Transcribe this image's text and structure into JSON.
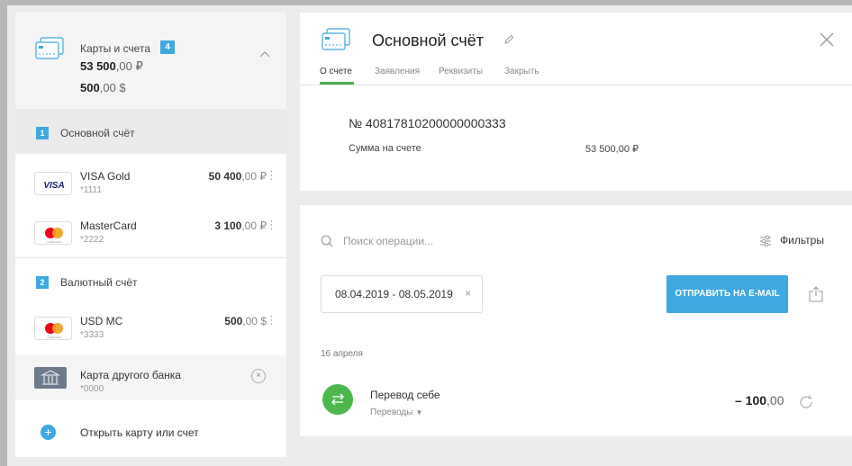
{
  "sidebar": {
    "header": {
      "title": "Карты и счета",
      "count": "4",
      "total_rub": {
        "main": "53 500",
        "fraction": ",00 ₽"
      },
      "total_usd": {
        "main": "500",
        "fraction": ",00 $"
      }
    },
    "groups": [
      {
        "number": "1",
        "label": "Основной счёт"
      },
      {
        "number": "2",
        "label": "Валютный счёт"
      }
    ],
    "cards": [
      {
        "brand": "VISA",
        "name": "VISA Gold",
        "number": "*1111",
        "amount_main": "50 400",
        "amount_fraction": ",00 ₽"
      },
      {
        "brand": "mastercard",
        "name": "MasterCard",
        "number": "*2222",
        "amount_main": "3 100",
        "amount_fraction": ",00 ₽"
      },
      {
        "brand": "mastercard",
        "name": "USD MC",
        "number": "*3333",
        "amount_main": "500",
        "amount_fraction": ",00 $"
      }
    ],
    "other_bank": {
      "name": "Карта другого банка",
      "number": "*0000"
    },
    "open_link": "Открыть карту или счет",
    "more_glyph": "⋮"
  },
  "account": {
    "title": "Основной счёт",
    "tabs": [
      "О счете",
      "Заявления",
      "Реквизиты",
      "Закрыть"
    ],
    "active_tab": "О счете",
    "number": "№ 40817810200000000333",
    "balance_label": "Сумма на счете",
    "balance_value": "53 500,00 ₽"
  },
  "operations": {
    "search_placeholder": "Поиск операции...",
    "filters_label": "Фильтры",
    "date_range": "08.04.2019 - 08.05.2019",
    "clear_glyph": "×",
    "email_button": "ОТПРАВИТЬ НА E-MAIL",
    "date_heading": "16 апреля",
    "items": [
      {
        "name": "Перевод себе",
        "category": "Переводы",
        "amount_main": "– 100",
        "amount_fraction": ",00"
      }
    ]
  },
  "colors": {
    "accent_blue": "#3ea8e0",
    "accent_green": "#4caf50",
    "op_green": "#4cb84c"
  }
}
